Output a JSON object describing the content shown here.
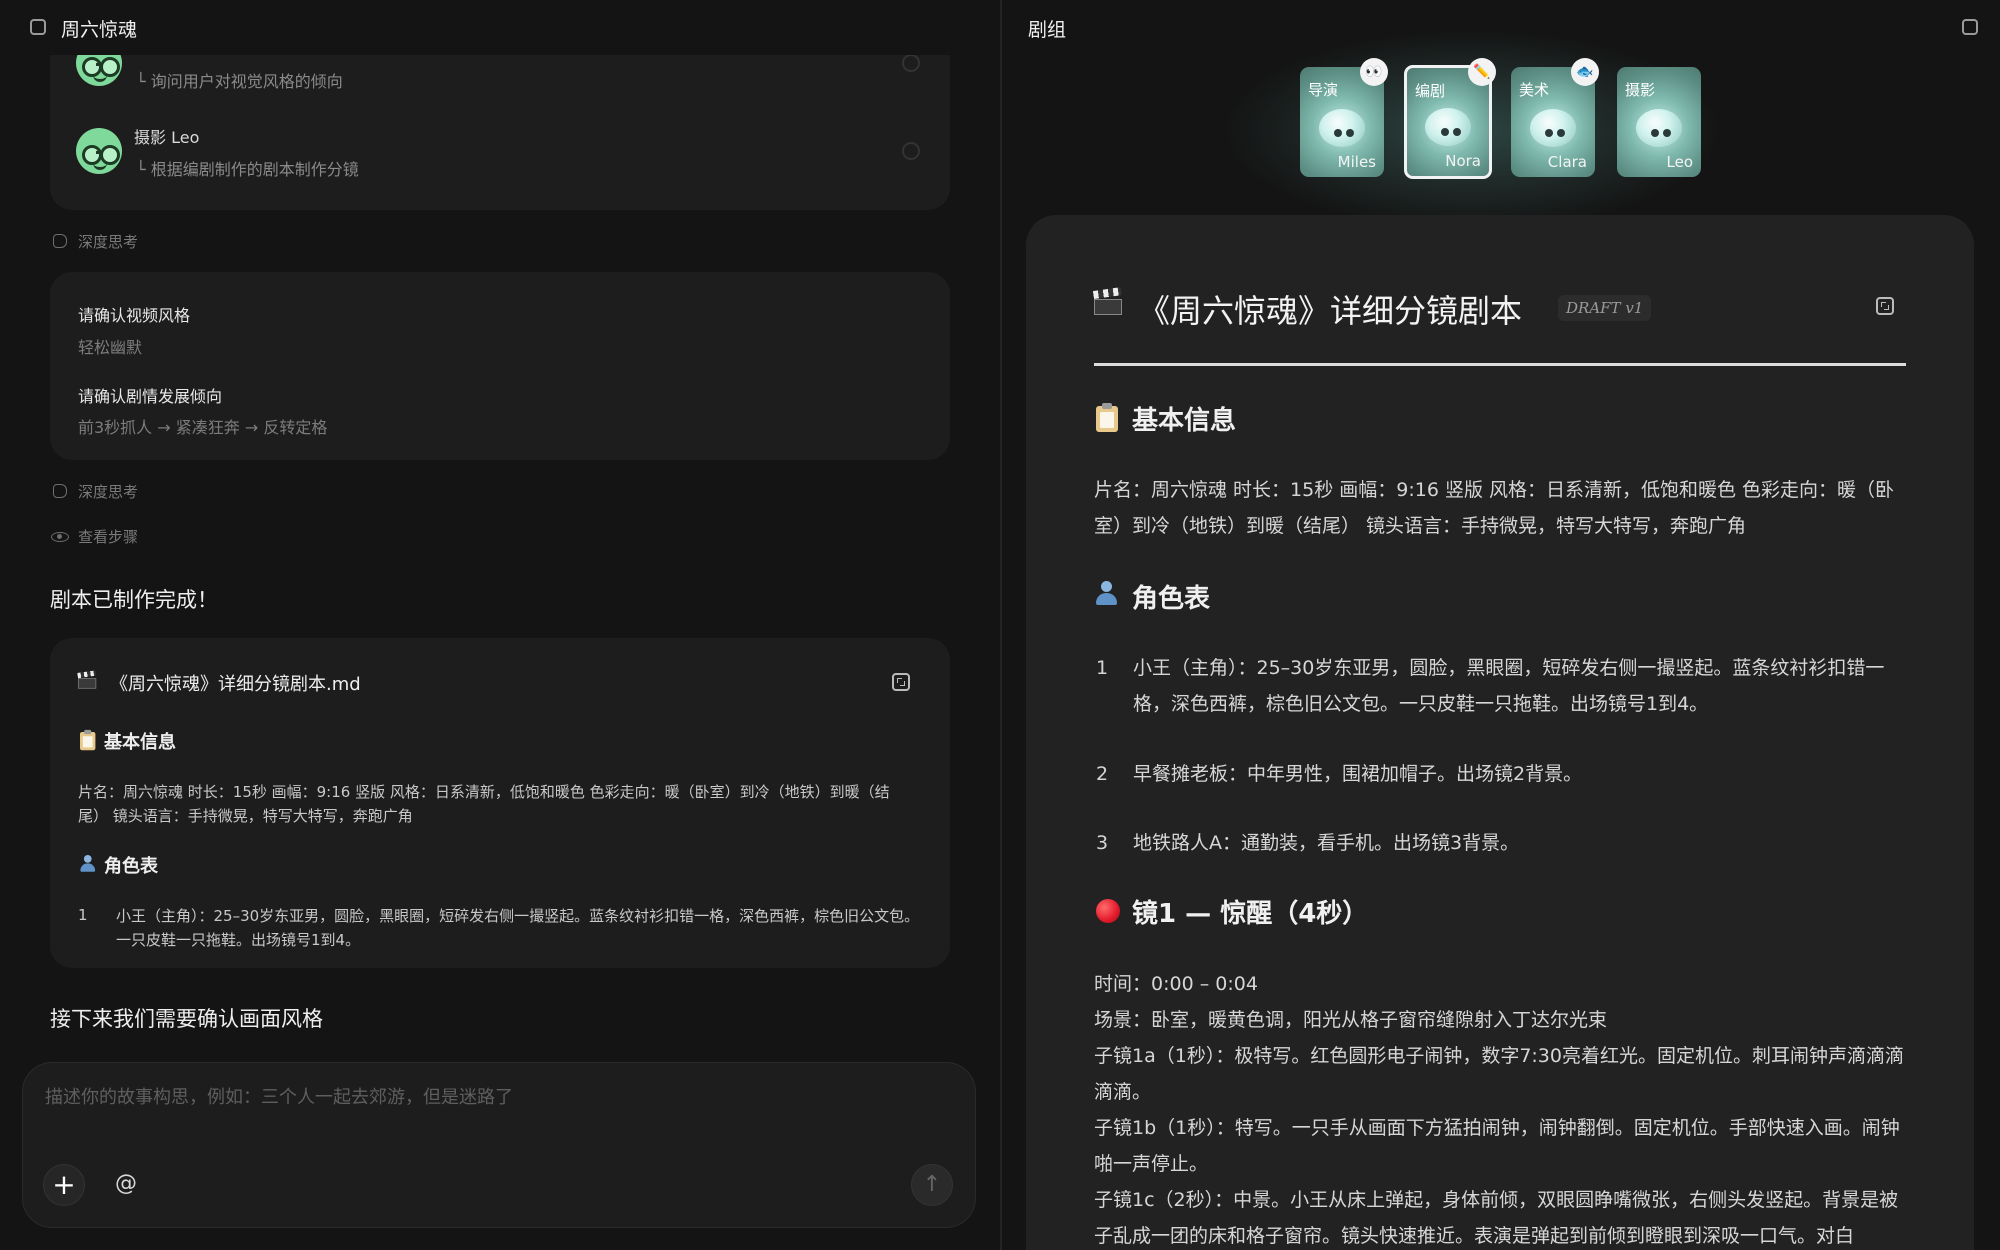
{
  "left": {
    "header_title": "周六惊魂",
    "crew_items": [
      {
        "name": "",
        "desc": "└ 询问用户对视觉风格的倾向"
      },
      {
        "name": "摄影 Leo",
        "desc": "└ 根据编剧制作的剧本制作分镜"
      }
    ],
    "deep_think_1": "深度思考",
    "confirm_card": {
      "q1": "请确认视频风格",
      "a1": "轻松幽默",
      "q2": "请确认剧情发展倾向",
      "a2": "前3秒抓人 → 紧凑狂奔 → 反转定格"
    },
    "deep_think_2": "深度思考",
    "view_steps": "查看步骤",
    "done_msg": "剧本已制作完成！",
    "file_card": {
      "title": "《周六惊魂》详细分镜剧本.md",
      "basic_heading": "基本信息",
      "basic_text": "片名：周六惊魂 时长：15秒 画幅：9:16 竖版 风格：日系清新，低饱和暖色 色彩走向：暖（卧室）到冷（地铁）到暖（结尾） 镜头语言：手持微晃，特写大特写，奔跑广角",
      "roles_heading": "角色表",
      "role1_num": "1",
      "role1_text": "小王（主角）：25–30岁东亚男，圆脸，黑眼圈，短碎发右侧一撮竖起。蓝条纹衬衫扣错一格，深色西裤，棕色旧公文包。一只皮鞋一只拖鞋。出场镜号1到4。"
    },
    "next_msg": "接下来我们需要确认画面风格",
    "composer": {
      "placeholder": "描述你的故事构思，例如：三个人一起去郊游，但是迷路了",
      "plus": "+",
      "at": "@",
      "send": "↑"
    }
  },
  "right": {
    "header_title": "剧组",
    "agents": [
      {
        "role": "导演",
        "name": "Miles",
        "badge": "👀"
      },
      {
        "role": "编剧",
        "name": "Nora",
        "badge": "✏️"
      },
      {
        "role": "美术",
        "name": "Clara",
        "badge": "🐟"
      },
      {
        "role": "摄影",
        "name": "Leo",
        "badge": ""
      }
    ],
    "doc": {
      "title": "《周六惊魂》详细分镜剧本",
      "badge": "DRAFT v1",
      "basic_heading": "基本信息",
      "basic_text": "片名：周六惊魂 时长：15秒 画幅：9:16 竖版 风格：日系清新，低饱和暖色 色彩走向：暖（卧室）到冷（地铁）到暖（结尾） 镜头语言：手持微晃，特写大特写，奔跑广角",
      "roles_heading": "角色表",
      "roles": [
        {
          "num": "1",
          "text": "小王（主角）：25–30岁东亚男，圆脸，黑眼圈，短碎发右侧一撮竖起。蓝条纹衬衫扣错一格，深色西裤，棕色旧公文包。一只皮鞋一只拖鞋。出场镜号1到4。"
        },
        {
          "num": "2",
          "text": "早餐摊老板：中年男性，围裙加帽子。出场镜2背景。"
        },
        {
          "num": "3",
          "text": "地铁路人A：通勤装，看手机。出场镜3背景。"
        }
      ],
      "shot1_heading": "镜1 — 惊醒（4秒）",
      "shot1_lines": [
        "时间：0:00 – 0:04",
        "场景：卧室，暖黄色调，阳光从格子窗帘缝隙射入丁达尔光束",
        "子镜1a（1秒）：极特写。红色圆形电子闹钟，数字7:30亮着红光。固定机位。刺耳闹钟声滴滴滴滴滴。",
        "子镜1b（1秒）：特写。一只手从画面下方猛拍闹钟，闹钟翻倒。固定机位。手部快速入画。闹钟啪一声停止。",
        "子镜1c（2秒）：中景。小王从床上弹起，身体前倾，双眼圆睁嘴微张，右侧头发竖起。背景是被子乱成一团的床和格子窗帘。镜头快速推近。表演是弹起到前倾到瞪眼到深吸一口气。对白"
      ]
    }
  }
}
